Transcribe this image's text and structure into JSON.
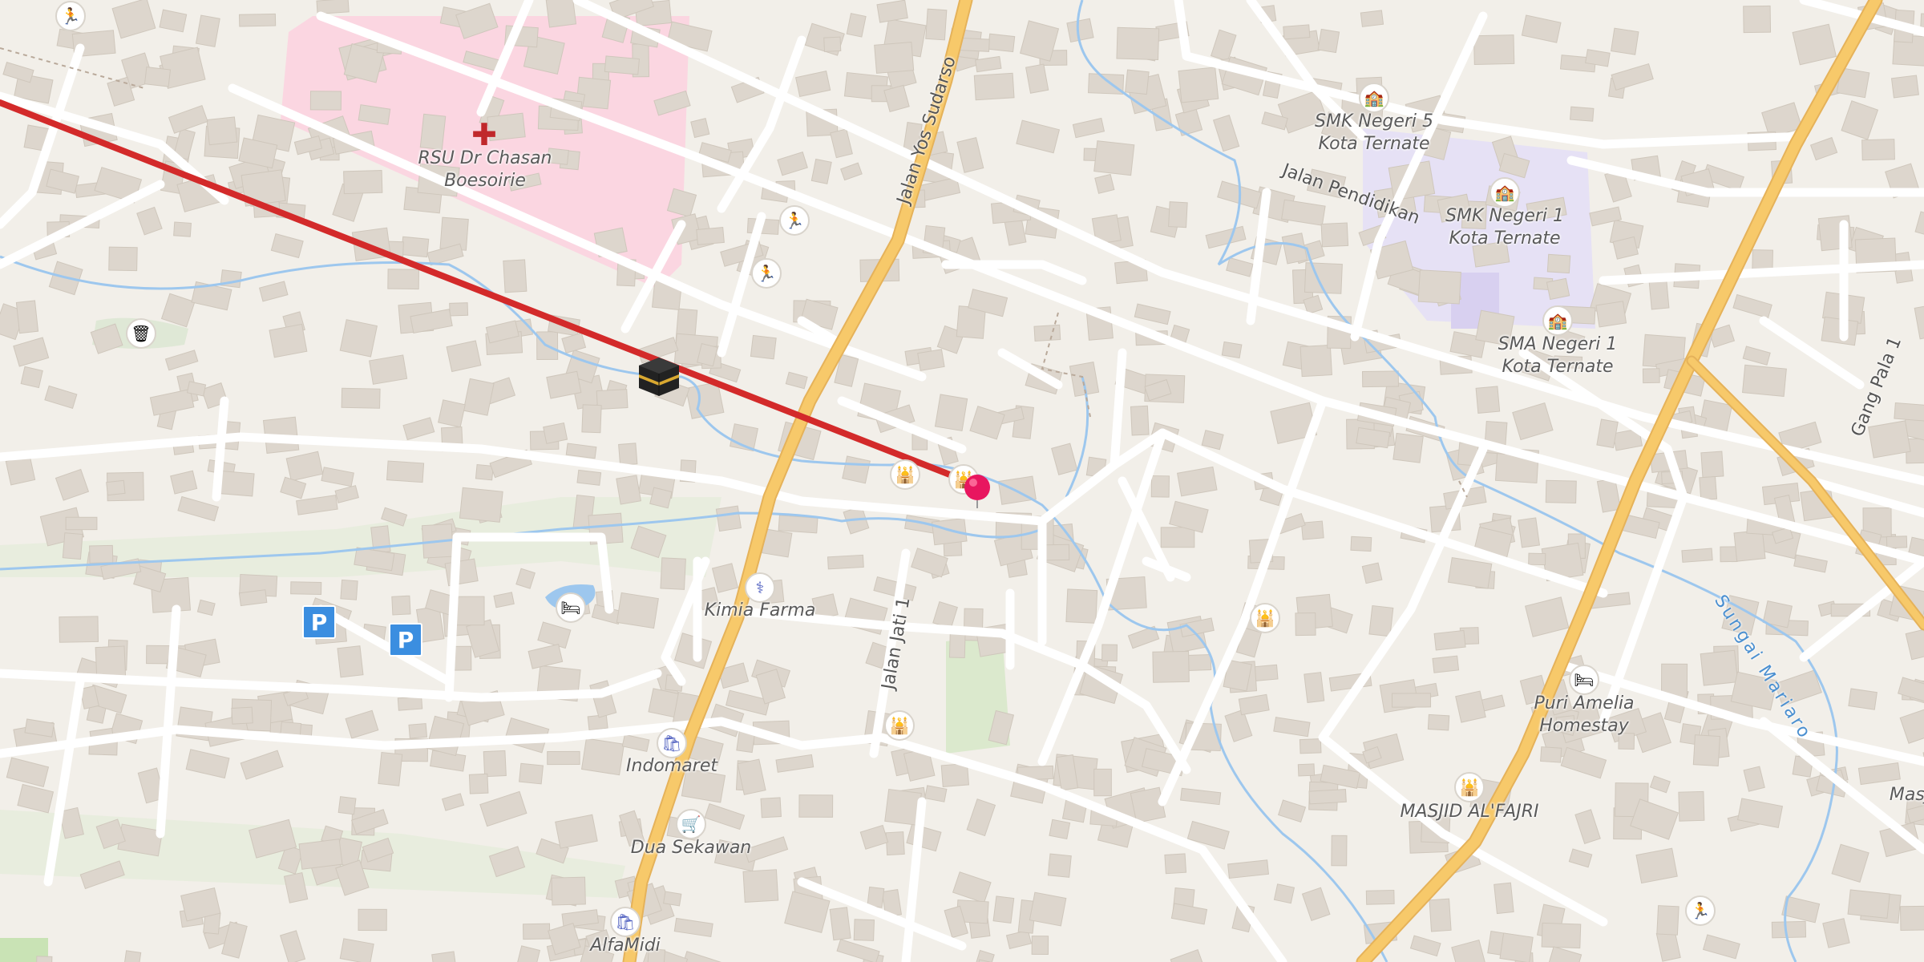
{
  "map": {
    "places": [
      {
        "id": "rsu",
        "text": "RSU Dr Chasan\nBoesoirie"
      },
      {
        "id": "smk5",
        "text": "SMK Negeri 5\nKota Ternate"
      },
      {
        "id": "smk1",
        "text": "SMK Negeri 1\nKota Ternate"
      },
      {
        "id": "sma1",
        "text": "SMA Negeri 1\nKota Ternate"
      },
      {
        "id": "kimia",
        "text": "Kimia Farma"
      },
      {
        "id": "indomaret",
        "text": "Indomaret"
      },
      {
        "id": "dua",
        "text": "Dua Sekawan"
      },
      {
        "id": "alfamidi",
        "text": "AlfaMidi"
      },
      {
        "id": "puri",
        "text": "Puri Amelia\nHomestay"
      },
      {
        "id": "masjid_fajri",
        "text": "MASJID AL'FAJRI"
      },
      {
        "id": "masji",
        "text": "Masji"
      }
    ],
    "streets": {
      "yos_sudarso": "Jalan Yos Sudarso",
      "pendidikan": "Jalan Pendidikan",
      "jati": "Jalan Jati 1",
      "gang_pala": "Gang Pala 1",
      "sungai": "Sungai Mariaro"
    },
    "icons": {
      "parking": "P",
      "hospital": "hospital-icon",
      "school": "school-icon",
      "mosque": "mosque-icon",
      "hotel": "hotel-icon",
      "pharmacy": "pharmacy-icon",
      "shop": "shop-icon",
      "supermarket": "cart-icon",
      "playground": "playground-icon",
      "waste": "waste-basket-icon",
      "kaaba": "kaaba-icon",
      "pin": "location-pin-icon"
    },
    "colors": {
      "background": "#f2efe9",
      "primary_road": "#f7c96a",
      "qibla_line": "#d32a2a",
      "water": "#9dc7ee",
      "hospital_area": "#fbd6e1",
      "school_area": "#e6e1f5",
      "pin": "#e8165f"
    }
  }
}
